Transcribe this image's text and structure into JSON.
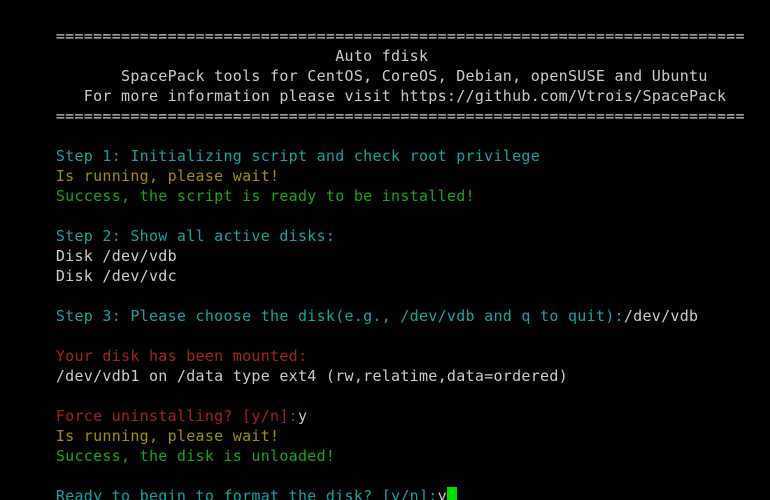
{
  "terminal": {
    "title": "Auto fdisk",
    "background": "#000000",
    "colors": {
      "white": "#cbcbcb",
      "cyan": "#17a2a2",
      "green": "#18a518",
      "yellow": "#9e9000",
      "red": "#a22222",
      "cursor": "#00e000"
    },
    "separator": "==========================================================================",
    "header": {
      "title_line": "                              Auto fdisk",
      "subtitle_line": "       SpacePack tools for CentOS, CoreOS, Debian, openSUSE and Ubuntu",
      "info_line": "   For more information please visit https://github.com/Vtrois/SpacePack"
    },
    "lines": {
      "step1": "Step 1: Initializing script and check root privilege",
      "step1_running": "Is running, please wait!",
      "step1_success": "Success, the script is ready to be installed!",
      "step2": "Step 2: Show all active disks:",
      "disk_1": "Disk /dev/vdb",
      "disk_2": "Disk /dev/vdc",
      "step3_prompt": "Step 3: Please choose the disk(e.g., /dev/vdb and q to quit):",
      "step3_input": "/dev/vdb",
      "mounted_warning": "Your disk has been mounted:",
      "mount_details": "/dev/vdb1 on /data type ext4 (rw,relatime,data=ordered)",
      "force_uninstall_prompt": "Force uninstalling? [y/n]:",
      "force_uninstall_input": "y",
      "unload_running": "Is running, please wait!",
      "unload_success": "Success, the disk is unloaded!",
      "format_prompt": "Ready to begin to format the disk? [y/n]:",
      "format_input": "y"
    }
  }
}
